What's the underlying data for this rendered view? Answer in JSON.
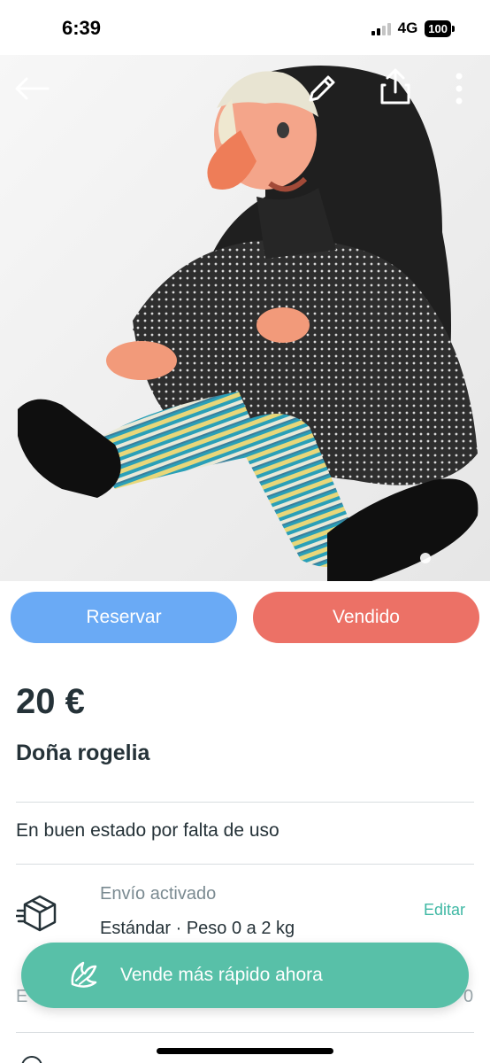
{
  "status_bar": {
    "time": "6:39",
    "network": "4G",
    "battery": "100"
  },
  "hero": {
    "image_description": "doll photo",
    "icons": {
      "back": "back-arrow-icon",
      "edit": "pencil-icon",
      "share": "share-icon",
      "more": "more-vertical-icon"
    }
  },
  "actions": {
    "reserve_label": "Reservar",
    "sold_label": "Vendido"
  },
  "listing": {
    "price": "20 €",
    "title": "Doña rogelia",
    "description": "En buen estado por falta de uso"
  },
  "shipping": {
    "icon": "package-icon",
    "title": "Envío activado",
    "detail": "Estándar · Peso 0 a 2 kg",
    "edit_label": "Editar"
  },
  "peek_row": {
    "left": "E",
    "right": "0"
  },
  "promo": {
    "icon": "wing-icon",
    "label": "Vende más rápido ahora"
  },
  "colors": {
    "reserve": "#6aaaf5",
    "sold": "#ec7166",
    "accent": "#58c0a8",
    "text": "#253238"
  }
}
